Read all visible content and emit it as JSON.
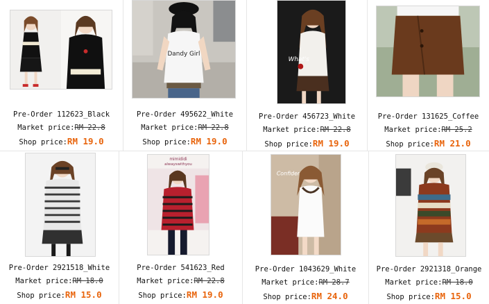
{
  "labels": {
    "market_price": "Market price:",
    "shop_price": "Shop price:"
  },
  "colors": {
    "shop_price": "#e8640c",
    "border": "#e6e6e6"
  },
  "products": [
    {
      "title": "Pre-Order 112623_Black",
      "market_price": "RM 22.8",
      "shop_price": "RM 19.0"
    },
    {
      "title": "Pre-Order 495622_White",
      "market_price": "RM 22.8",
      "shop_price": "RM 19.0",
      "shirt_text": "Dandy Girl"
    },
    {
      "title": "Pre-Order 456723_White",
      "market_price": "RM 22.8",
      "shop_price": "RM 19.0",
      "overlay_text": "What's"
    },
    {
      "title": "Pre-Order 131625_Coffee",
      "market_price": "RM 25.2",
      "shop_price": "RM 21.0"
    },
    {
      "title": "Pre-Order 2921518_White",
      "market_price": "RM 18.0",
      "shop_price": "RM 15.0"
    },
    {
      "title": "Pre-Order 541623_Red",
      "market_price": "RM 22.8",
      "shop_price": "RM 19.0",
      "overlay_text": "mimididi",
      "overlay_text_2": "alwayswithyou"
    },
    {
      "title": "Pre-Order 1043629_White",
      "market_price": "RM 28.7",
      "shop_price": "RM 24.0",
      "overlay_text": "Confidence"
    },
    {
      "title": "Pre-Order 2921318_Orange",
      "market_price": "RM 18.0",
      "shop_price": "RM 15.0"
    }
  ]
}
